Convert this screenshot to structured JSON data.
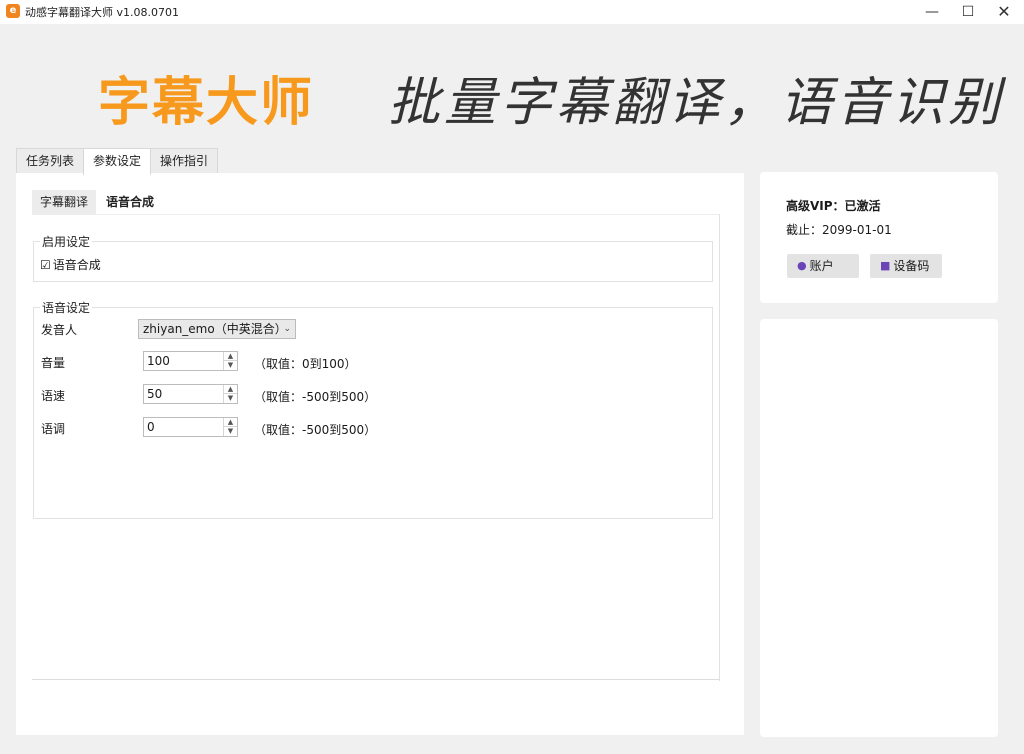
{
  "window": {
    "title": "动感字幕翻译大师 v1.08.0701",
    "icon_letter": "e",
    "minimize": "—",
    "maximize": "☐",
    "close": "✕"
  },
  "banner": {
    "brand": "字幕大师",
    "slogan": "批量字幕翻译，语音识别",
    "brand_color": "#f7991c"
  },
  "top_tabs": [
    {
      "label": "任务列表",
      "active": false
    },
    {
      "label": "参数设定",
      "active": true
    },
    {
      "label": "操作指引",
      "active": false
    }
  ],
  "sub_tabs": [
    {
      "label": "字幕翻译",
      "active": true
    },
    {
      "label": "语音合成",
      "active": false
    }
  ],
  "enable_group": {
    "title": "启用设定",
    "checkbox_mark": "☑",
    "checkbox_label": "语音合成",
    "checked": true
  },
  "voice_group": {
    "title": "语音设定",
    "speaker_label": "发音人",
    "speaker_value": "zhiyan_emo（中英混合）",
    "volume_label": "音量",
    "volume_value": "100",
    "volume_hint": "（取值：0到100）",
    "speed_label": "语速",
    "speed_value": "50",
    "speed_hint": "（取值：-500到500）",
    "pitch_label": "语调",
    "pitch_value": "0",
    "pitch_hint": "（取值：-500到500）"
  },
  "vip": {
    "status": "高级VIP：已激活",
    "expire": "截止：2099-01-01",
    "account_button": "账户",
    "device_button": "设备码",
    "icon_color": "#6b45b8"
  }
}
